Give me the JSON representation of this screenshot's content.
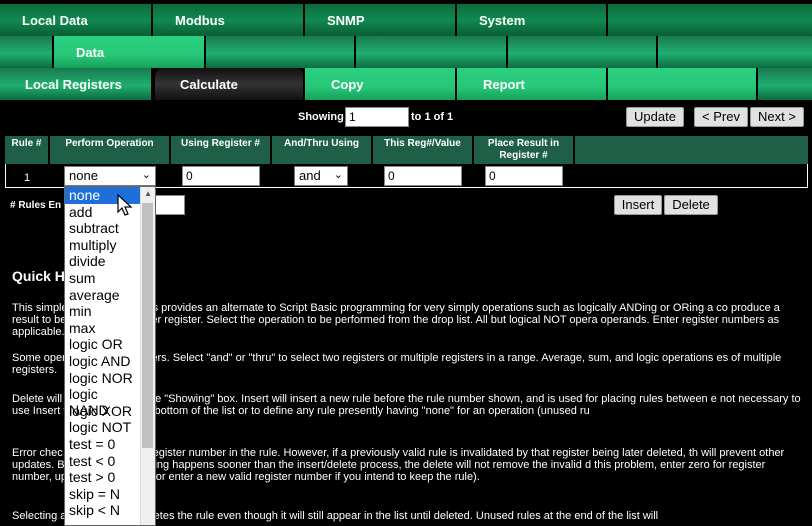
{
  "nav": {
    "row1": [
      "Local Data",
      "Modbus",
      "SNMP",
      "System",
      ""
    ],
    "row2": [
      "",
      "Data",
      "",
      "",
      "",
      ""
    ],
    "row3": [
      "Local Registers",
      "Calculate",
      "Copy",
      "Report",
      "",
      ""
    ]
  },
  "paging": {
    "showing_label": "Showing",
    "showing_value": "1",
    "of_text": "to 1 of 1",
    "update": "Update",
    "prev": "< Prev",
    "next": "Next >"
  },
  "table": {
    "headers": [
      "Rule #",
      "Perform Operation",
      "Using Register #",
      "And/Thru Using",
      "This Reg#/Value",
      "Place Result in Register #"
    ],
    "row": {
      "rule": "1",
      "operation": "none",
      "using": "0",
      "andthru": "and",
      "thisreg": "0",
      "result": "0"
    }
  },
  "rules_entry_label": "# Rules En",
  "buttons": {
    "insert": "Insert",
    "delete": "Delete"
  },
  "dropdown": [
    "none",
    "add",
    "subtract",
    "multiply",
    "divide",
    "sum",
    "average",
    "min",
    "max",
    "logic OR",
    "logic AND",
    "logic NOR",
    "logic NAND",
    "logic XOR",
    "logic NOT",
    "test = 0",
    "test < 0",
    "test > 0",
    "skip = N",
    "skip < N"
  ],
  "help": {
    "title": "Quick H",
    "p1": "This simple                set of calculations provides an alternate to Script Basic programming for very simply operations such as logically ANDing or ORing a co                 produce a result to be sent out to another register. Select the operation to be performed from the drop list. All but logical NOT opera                 operands. Enter register numbers as applicable.",
    "p2": "Some oper                 r ranges of registers. Select \"and\" or \"thru\" to select two registers or multiple registers in a range. Average, sum, and logic operations                 es of multiple registers.",
    "p3": "Delete will                 umber shown in the \"Showing\" box. Insert will insert a new rule before the rule number shown, and is used for placing rules between e                 not necessary to use Insert to add rules to the bottom of the list or to define any rule presently having \"none\" for an operation (unused ru",
    "p4": "Error chec                 ntry of an invalid register number in the rule. However, if a previously valid rule is invalidated by that register being later deleted, th                 will prevent other updates. Because error trapping happens sooner than the insert/delete process, the delete will not remove the invalid                 d this problem, enter zero for register number, update, then delete (or enter a new valid register number if you intend to keep the rule).",
    "p5": "Selecting                 ation effectively deletes the rule even though it will still appear in the list until deleted. Unused rules at the end of the list will"
  }
}
